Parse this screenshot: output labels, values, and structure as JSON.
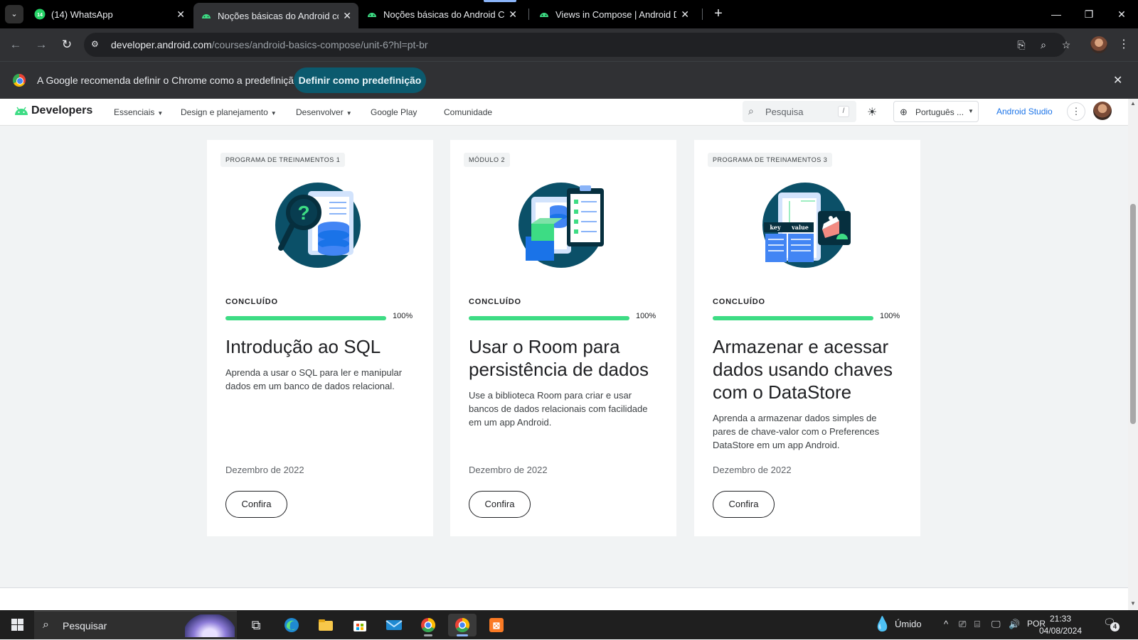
{
  "browser": {
    "tabs": [
      {
        "label": "(14) WhatsApp",
        "icon": "whatsapp-icon",
        "badge": "14"
      },
      {
        "label": "Noções básicas do Android com",
        "icon": "android-icon",
        "active": true
      },
      {
        "label": "Noções básicas do Android Com",
        "icon": "android-icon"
      },
      {
        "label": "Views in Compose  |  Android D",
        "icon": "android-icon"
      }
    ],
    "new_tab": "+",
    "window": {
      "minimize": "—",
      "restore": "❐",
      "close": "✕"
    },
    "url_host": "developer.android.com",
    "url_path": "/courses/android-basics-compose/unit-6?hl=pt-br"
  },
  "infobar": {
    "text": "A Google recomenda definir o Chrome como a predefinição",
    "button": "Definir como predefinição"
  },
  "site": {
    "logo": "Developers",
    "nav": [
      {
        "label": "Essenciais",
        "dropdown": true
      },
      {
        "label": "Design e planejamento",
        "dropdown": true
      },
      {
        "label": "Desenvolver",
        "dropdown": true
      },
      {
        "label": "Google Play",
        "dropdown": false
      },
      {
        "label": "Comunidade",
        "dropdown": false
      }
    ],
    "search_placeholder": "Pesquisa",
    "search_key": "/",
    "language": "Português ...",
    "studio": "Android Studio"
  },
  "cards": [
    {
      "badge": "PROGRAMA DE TREINAMENTOS 1",
      "status": "CONCLUÍDO",
      "progress": 100,
      "progress_label": "100%",
      "title": "Introdução ao SQL",
      "description": "Aprenda a usar o SQL para ler e manipular dados em um banco de dados relacional.",
      "date": "Dezembro de 2022",
      "cta": "Confira",
      "illustration": "magnifier-database-illustration"
    },
    {
      "badge": "MÓDULO 2",
      "status": "CONCLUÍDO",
      "progress": 100,
      "progress_label": "100%",
      "title": "Usar o Room para persistência de dados",
      "description": "Use a biblioteca Room para criar e usar bancos de dados relacionais com facilidade em um app Android.",
      "date": "Dezembro de 2022",
      "cta": "Confira",
      "illustration": "clipboard-database-illustration"
    },
    {
      "badge": "PROGRAMA DE TREINAMENTOS 3",
      "status": "CONCLUÍDO",
      "progress": 100,
      "progress_label": "100%",
      "title": "Armazenar e acessar dados usando chaves com o DataStore",
      "description": "Aprenda a armazenar dados simples de pares de chave-valor com o Preferences DataStore em um app Android.",
      "date": "Dezembro de 2022",
      "cta": "Confira",
      "illustration": "key-value-datastore-illustration",
      "illustration_labels": [
        "key",
        "value"
      ]
    }
  ],
  "taskbar": {
    "search": "Pesquisar",
    "weather": "Úmido",
    "lang": "POR",
    "time": "21:33",
    "date": "04/08/2024",
    "notifications": "4"
  }
}
